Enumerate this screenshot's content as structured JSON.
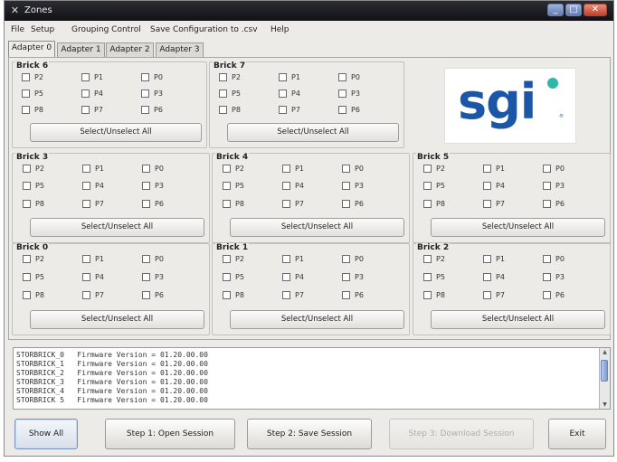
{
  "window": {
    "title": "Zones"
  },
  "menu": [
    "File",
    "Setup",
    "Grouping Control",
    "Save Configuration to .csv",
    "Help"
  ],
  "tabs": [
    "Adapter 0",
    "Adapter 1",
    "Adapter 2",
    "Adapter 3"
  ],
  "bricks": [
    {
      "title": "Brick 6",
      "ports": [
        "P2",
        "P1",
        "P0",
        "P5",
        "P4",
        "P3",
        "P8",
        "P7",
        "P6"
      ],
      "button": "Select/Unselect All"
    },
    {
      "title": "Brick 7",
      "ports": [
        "P2",
        "P1",
        "P0",
        "P5",
        "P4",
        "P3",
        "P8",
        "P7",
        "P6"
      ],
      "button": "Select/Unselect All"
    },
    {
      "title": "Brick 3",
      "ports": [
        "P2",
        "P1",
        "P0",
        "P5",
        "P4",
        "P3",
        "P8",
        "P7",
        "P6"
      ],
      "button": "Select/Unselect All"
    },
    {
      "title": "Brick 4",
      "ports": [
        "P2",
        "P1",
        "P0",
        "P5",
        "P4",
        "P3",
        "P8",
        "P7",
        "P6"
      ],
      "button": "Select/Unselect All"
    },
    {
      "title": "Brick 5",
      "ports": [
        "P2",
        "P1",
        "P0",
        "P5",
        "P4",
        "P3",
        "P8",
        "P7",
        "P6"
      ],
      "button": "Select/Unselect All"
    },
    {
      "title": "Brick 0",
      "ports": [
        "P2",
        "P1",
        "P0",
        "P5",
        "P4",
        "P3",
        "P8",
        "P7",
        "P6"
      ],
      "button": "Select/Unselect All"
    },
    {
      "title": "Brick 1",
      "ports": [
        "P2",
        "P1",
        "P0",
        "P5",
        "P4",
        "P3",
        "P8",
        "P7",
        "P6"
      ],
      "button": "Select/Unselect All"
    },
    {
      "title": "Brick 2",
      "ports": [
        "P2",
        "P1",
        "P0",
        "P5",
        "P4",
        "P3",
        "P8",
        "P7",
        "P6"
      ],
      "button": "Select/Unselect All"
    }
  ],
  "logo": {
    "text": "sgi",
    "registered": "®"
  },
  "log_lines": [
    "STORBRICK_0   Firmware Version = 01.20.00.00",
    "STORBRICK_1   Firmware Version = 01.20.00.00",
    "STORBRICK_2   Firmware Version = 01.20.00.00",
    "STORBRICK_3   Firmware Version = 01.20.00.00",
    "STORBRICK_4   Firmware Version = 01.20.00.00",
    "STORBRICK_5   Firmware Version = 01.20.00.00"
  ],
  "buttons": {
    "show_all": "Show All",
    "step1": "Step 1: Open Session",
    "step2": "Step 2: Save Session",
    "step3": "Step 3: Download Session",
    "exit": "Exit"
  },
  "colors": {
    "sgi_blue": "#1b57a6",
    "sgi_dot": "#2fb7a8"
  }
}
